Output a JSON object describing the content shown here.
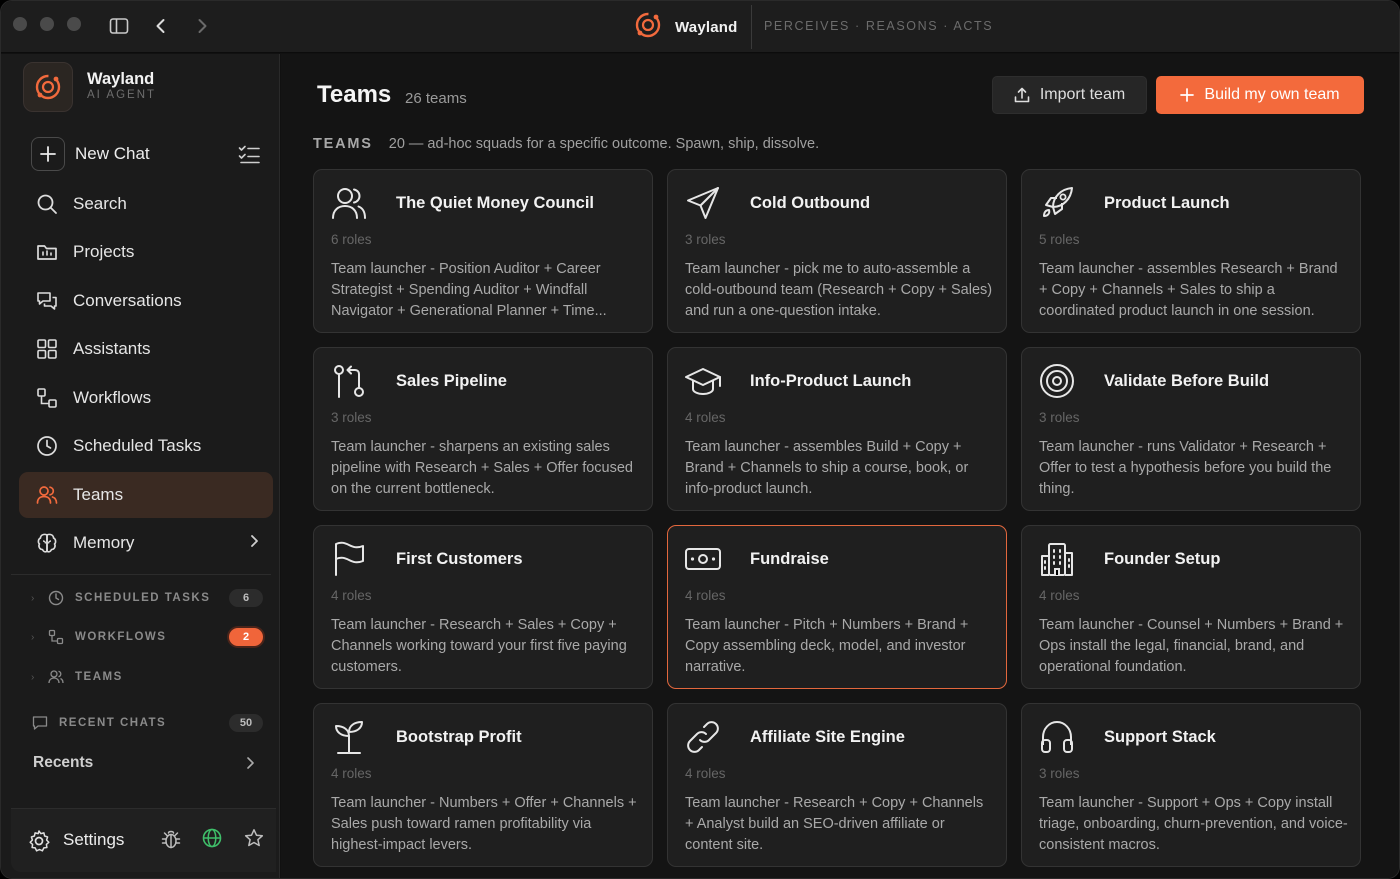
{
  "titlebar": {
    "brand_name": "Wayland",
    "tagline": "PERCEIVES · REASONS · ACTS"
  },
  "sidebar": {
    "app_name": "Wayland",
    "app_subtitle": "AI AGENT",
    "new_chat_label": "New Chat",
    "nav": [
      {
        "label": "Search",
        "icon": "search-icon"
      },
      {
        "label": "Projects",
        "icon": "folder-icon"
      },
      {
        "label": "Conversations",
        "icon": "chat-icon"
      },
      {
        "label": "Assistants",
        "icon": "grid-icon"
      },
      {
        "label": "Workflows",
        "icon": "workflow-icon"
      },
      {
        "label": "Scheduled Tasks",
        "icon": "clock-icon"
      },
      {
        "label": "Teams",
        "icon": "users-icon",
        "active": true
      },
      {
        "label": "Memory",
        "icon": "brain-icon"
      }
    ],
    "sections": [
      {
        "label": "SCHEDULED TASKS",
        "count": "6"
      },
      {
        "label": "WORKFLOWS",
        "count": "2"
      },
      {
        "label": "TEAMS",
        "count": ""
      },
      {
        "label": "RECENT CHATS",
        "count": "50"
      }
    ],
    "recents_label": "Recents",
    "settings_label": "Settings"
  },
  "main": {
    "title": "Teams",
    "count": "26 teams",
    "import_label": "Import team",
    "build_label": "Build my own team",
    "section_title": "TEAMS",
    "section_desc": "20 — ad-hoc squads for a specific outcome. Spawn, ship, dissolve.",
    "cards": [
      {
        "title": "The Quiet Money Council",
        "roles": "6 roles",
        "icon": "users-icon",
        "desc": "Team launcher - Position Auditor + Career Strategist + Spending Auditor + Windfall Navigator + Generational Planner + Time..."
      },
      {
        "title": "Cold Outbound",
        "roles": "3 roles",
        "icon": "send-icon",
        "desc": "Team launcher - pick me to auto-assemble a cold-outbound team (Research + Copy + Sales) and run a one-question intake."
      },
      {
        "title": "Product Launch",
        "roles": "5 roles",
        "icon": "rocket-icon",
        "desc": "Team launcher - assembles Research + Brand + Copy + Channels + Sales to ship a coordinated product launch in one session."
      },
      {
        "title": "Sales Pipeline",
        "roles": "3 roles",
        "icon": "git-pull-icon",
        "desc": "Team launcher - sharpens an existing sales pipeline with Research + Sales + Offer focused on the current bottleneck."
      },
      {
        "title": "Info-Product Launch",
        "roles": "4 roles",
        "icon": "graduation-cap-icon",
        "desc": "Team launcher - assembles Build + Copy + Brand + Channels to ship a course, book, or info-product launch."
      },
      {
        "title": "Validate Before Build",
        "roles": "3 roles",
        "icon": "target-icon",
        "desc": "Team launcher - runs Validator + Research + Offer to test a hypothesis before you build the thing."
      },
      {
        "title": "First Customers",
        "roles": "4 roles",
        "icon": "flag-icon",
        "desc": "Team launcher - Research + Sales + Copy + Channels working toward your first five paying customers."
      },
      {
        "title": "Fundraise",
        "roles": "4 roles",
        "icon": "banknote-icon",
        "desc": "Team launcher - Pitch + Numbers + Brand + Copy assembling deck, model, and investor narrative.",
        "highlight": true
      },
      {
        "title": "Founder Setup",
        "roles": "4 roles",
        "icon": "building-icon",
        "desc": "Team launcher - Counsel + Numbers + Brand + Ops install the legal, financial, brand, and operational foundation."
      },
      {
        "title": "Bootstrap Profit",
        "roles": "4 roles",
        "icon": "sprout-icon",
        "desc": "Team launcher - Numbers + Offer + Channels + Sales push toward ramen profitability via highest-impact levers."
      },
      {
        "title": "Affiliate Site Engine",
        "roles": "4 roles",
        "icon": "link-icon",
        "desc": "Team launcher - Research + Copy + Channels + Analyst build an SEO-driven affiliate or content site."
      },
      {
        "title": "Support Stack",
        "roles": "3 roles",
        "icon": "headphones-icon",
        "desc": "Team launcher - Support + Ops + Copy install triage, onboarding, churn-prevention, and voice-consistent macros."
      }
    ]
  },
  "colors": {
    "accent": "#f36a3c",
    "active_nav_bg": "#3a2a22",
    "card_bg": "#1f1f1f",
    "main_bg": "#141414",
    "sidebar_bg": "#1b1b1b"
  }
}
